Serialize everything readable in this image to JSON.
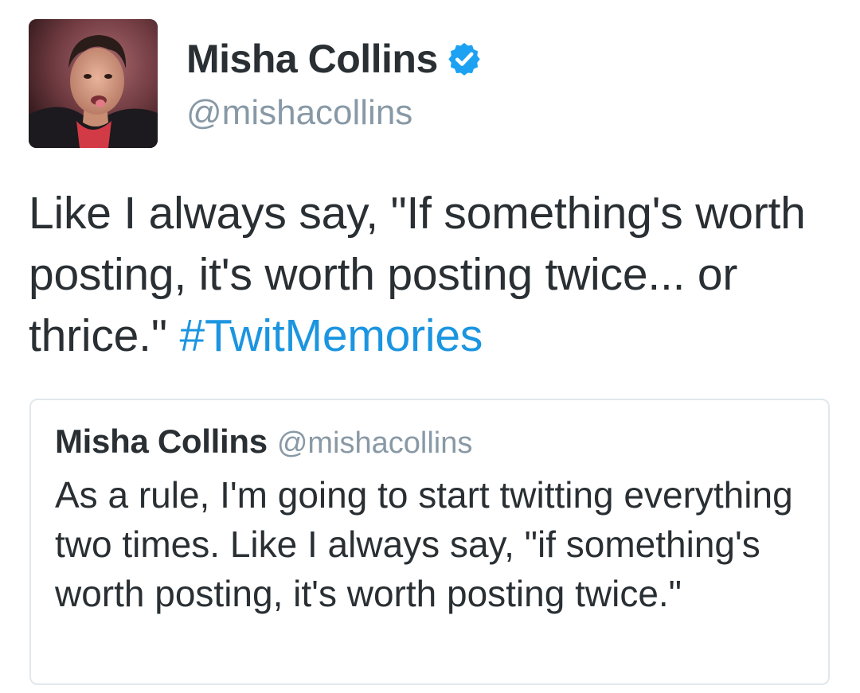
{
  "tweet": {
    "author": {
      "display_name": "Misha Collins",
      "handle": "@mishacollins",
      "verified_icon": "verified-badge-icon",
      "avatar": "profile-photo"
    },
    "text": "Like I always say, \"If something's worth posting, it's worth posting twice... or thrice.\"",
    "hashtag": "#TwitMemories"
  },
  "quoted_tweet": {
    "display_name": "Misha Collins",
    "handle": "@mishacollins",
    "text": "As a rule, I'm going to start twitting everything two times. Like I always say, \"if something's worth posting, it's worth posting twice.\""
  },
  "colors": {
    "text": "#292f33",
    "secondary": "#8899a6",
    "link": "#1b95e0",
    "verified": "#1da1f2",
    "card_border": "#e1e8ed"
  }
}
